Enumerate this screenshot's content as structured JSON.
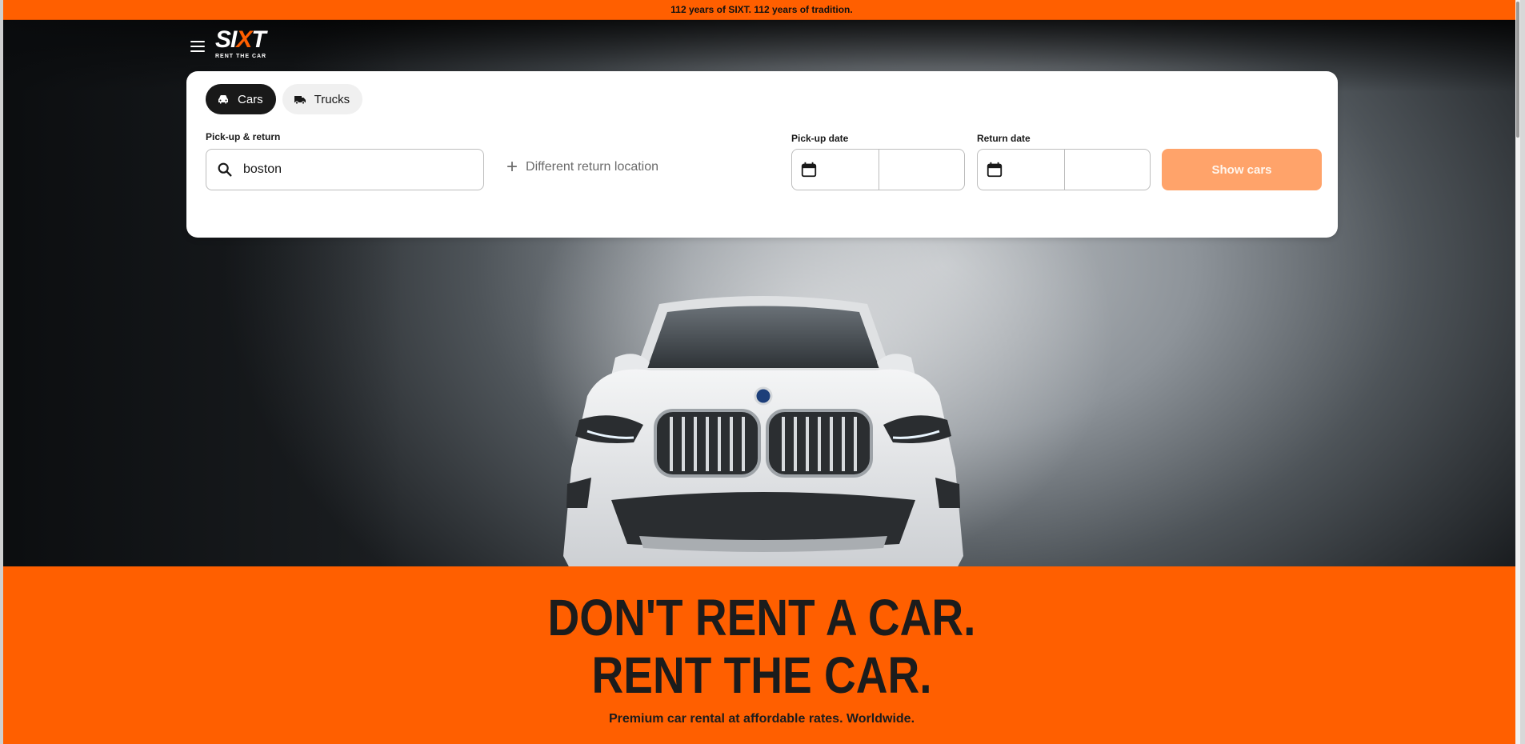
{
  "banner": {
    "text": "112 years of SIXT. 112 years of tradition."
  },
  "header": {
    "menu_icon": "hamburger-icon",
    "logo": {
      "text_main": "SIXT",
      "tagline": "RENT THE CAR"
    }
  },
  "search": {
    "tabs": [
      {
        "label": "Cars",
        "icon": "car-icon",
        "active": true
      },
      {
        "label": "Trucks",
        "icon": "truck-icon",
        "active": false
      }
    ],
    "pickup_return_label": "Pick-up & return",
    "location_value": "boston",
    "different_return_label": "Different return location",
    "pickup_date_label": "Pick-up date",
    "return_date_label": "Return date",
    "show_cars_label": "Show cars"
  },
  "hero": {
    "headline_line1": "DON'T RENT A CAR.",
    "headline_line2": "RENT THE CAR.",
    "subline": "Premium car rental at affordable rates. Worldwide."
  },
  "colors": {
    "brand_orange": "#ff5f00",
    "button_disabled": "#ffa36a",
    "tab_active": "#191919"
  }
}
